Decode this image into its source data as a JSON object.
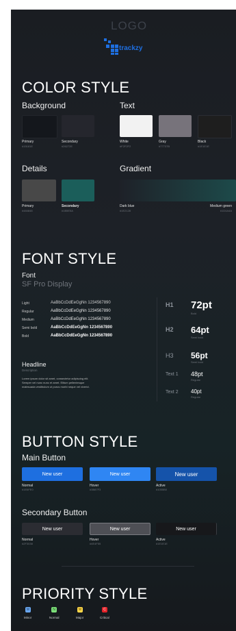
{
  "header": {
    "logo_text": "LOGO",
    "brand_name": "trackzy",
    "brand_color": "#1e6fe0"
  },
  "color_style": {
    "title": "COLOR STYLE",
    "background_title": "Background",
    "text_title": "Text",
    "details_title": "Details",
    "gradient_title": "Gradient",
    "background": [
      {
        "label": "Primary",
        "hex": "#15181E",
        "color": "#14171c"
      },
      {
        "label": "Secondary",
        "hex": "#26272E",
        "color": "#25262d"
      }
    ],
    "text": [
      {
        "label": "White",
        "hex": "#F2F2F2",
        "color": "#f2f2f2"
      },
      {
        "label": "Gray",
        "hex": "#77737B",
        "color": "#77737b"
      },
      {
        "label": "Black",
        "hex": "#1E1E1E",
        "color": "#1e1e1e"
      }
    ],
    "details": [
      {
        "label": "Primary",
        "hex": "#484848",
        "color": "#484848"
      },
      {
        "label": "Secondary",
        "hex": "#1B5E5A",
        "color": "#1b5e5a"
      }
    ],
    "gradient": {
      "start_label": "Dark blue",
      "start_hex": "#1E2128",
      "start_color": "#1e2128",
      "end_label": "Medium green",
      "end_hex": "#1D4A4A",
      "end_color": "#1d4a4a"
    }
  },
  "font_style": {
    "title": "FONT STYLE",
    "font_label": "Font",
    "font_name": "SF Pro Display",
    "weights": [
      {
        "name": "Light",
        "sample": "AaBbCcDdEeGgNn 1234567890"
      },
      {
        "name": "Regular",
        "sample": "AaBbCcDdEeGgNn 1234567890"
      },
      {
        "name": "Medium",
        "sample": "AaBbCcDdEeGgNn 1234567890"
      },
      {
        "name": "Semi bold",
        "sample": "AaBbCcDdEeGgNn 1234567890"
      },
      {
        "name": "Bold",
        "sample": "AaBbCcDdEeGgNn 1234567890"
      }
    ],
    "headline": "Headline",
    "description": "Description",
    "body_text": [
      "Lorem ipsum dolor sit amet, consectetur adipiscing elit.",
      "Semper vel nunc nunc et amet. Elitum pellentesque",
      "malesuada vestibulum ut purus morbi neque vel viverid."
    ],
    "sizes": [
      {
        "label": "H1",
        "size": "72pt",
        "weight": "Bold"
      },
      {
        "label": "H2",
        "size": "64pt",
        "weight": "Semi bold"
      },
      {
        "label": "H3",
        "size": "56pt",
        "weight": "Semi bold"
      },
      {
        "label": "Text 1",
        "size": "48pt",
        "weight": "Regular"
      },
      {
        "label": "Text 2",
        "size": "40pt",
        "weight": "Regular"
      }
    ]
  },
  "button_style": {
    "title": "BUTTON STYLE",
    "main_title": "Main Button",
    "secondary_title": "Secondary Button",
    "main": [
      {
        "label": "New user",
        "state": "Normal",
        "hex": "#1E6FE0",
        "color": "#1e6fe0"
      },
      {
        "label": "New user",
        "state": "Hover",
        "hex": "#3B87F3",
        "color": "#2f86f3"
      },
      {
        "label": "New user",
        "state": "Active",
        "hex": "#1055B0",
        "color": "#1553aa"
      }
    ],
    "secondary": [
      {
        "label": "New user",
        "state": "Normal",
        "hex": "#2F3038",
        "color": "#2b2c32"
      },
      {
        "label": "New user",
        "state": "Hover",
        "hex": "#4E4F55",
        "color": "#4e4f55"
      },
      {
        "label": "New user",
        "state": "Active",
        "hex": "#1E1E1E",
        "color": "#17181b"
      }
    ]
  },
  "priority_style": {
    "title": "PRIORITY STYLE",
    "items": [
      {
        "letter": "M",
        "label": "Minor",
        "color": "#6aa7f0",
        "text_color": "#1f3d63"
      },
      {
        "letter": "N",
        "label": "Normal",
        "color": "#7de07a",
        "text_color": "#1f4f1d"
      },
      {
        "letter": "M",
        "label": "Major",
        "color": "#ffd84a",
        "text_color": "#5a4400"
      },
      {
        "letter": "C",
        "label": "Critical",
        "color": "#e3232a",
        "text_color": "#ffffff"
      }
    ]
  }
}
